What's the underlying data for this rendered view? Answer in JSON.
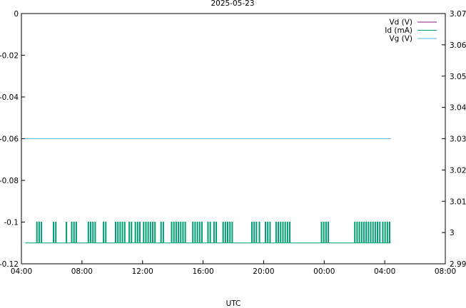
{
  "chart_data": {
    "type": "line",
    "title": "2025-05-23",
    "xlabel": "UTC",
    "ylabel_left": "",
    "ylabel_right": "",
    "x_range_hours": [
      4,
      32
    ],
    "x_ticks": [
      "04:00",
      "08:00",
      "12:00",
      "16:00",
      "20:00",
      "00:00",
      "04:00",
      "08:00"
    ],
    "y_left_range": [
      -0.12,
      0
    ],
    "y_left_ticks": [
      "-0.12",
      "-0.1",
      "-0.08",
      "-0.06",
      "-0.04",
      "-0.02",
      "0"
    ],
    "y_right_range": [
      2.99,
      3.07
    ],
    "y_right_ticks": [
      "2.99",
      "3",
      "3.01",
      "3.02",
      "3.03",
      "3.04",
      "3.05",
      "3.06",
      "3.07"
    ],
    "grid": false,
    "legend_position": "top-right",
    "series": [
      {
        "name": "Vd (V)",
        "color": "#8b1a89",
        "axis": "left",
        "points": []
      },
      {
        "name": "Id (mA)",
        "color": "#009e73",
        "axis": "left",
        "baseline": -0.11,
        "spike_value": -0.1,
        "x_start": 4.25,
        "x_end": 28.4,
        "spike_times": [
          5.0,
          5.15,
          5.3,
          6.1,
          6.25,
          6.95,
          7.3,
          7.45,
          7.6,
          8.4,
          8.55,
          8.7,
          8.85,
          9.4,
          9.55,
          10.2,
          10.35,
          10.5,
          10.65,
          10.8,
          11.1,
          11.25,
          11.5,
          11.65,
          11.8,
          12.05,
          12.2,
          12.35,
          12.5,
          12.65,
          12.8,
          13.2,
          13.35,
          13.9,
          14.05,
          14.2,
          14.35,
          14.5,
          14.65,
          14.8,
          15.3,
          15.45,
          15.6,
          15.75,
          15.9,
          16.3,
          16.45,
          16.7,
          16.85,
          17.3,
          17.45,
          17.6,
          17.75,
          17.9,
          19.2,
          19.35,
          19.5,
          19.7,
          20.1,
          20.25,
          20.4,
          20.8,
          20.95,
          21.1,
          21.25,
          21.4,
          21.55,
          21.7,
          23.8,
          23.95,
          24.1,
          24.25,
          26.0,
          26.15,
          26.3,
          26.45,
          26.6,
          26.75,
          26.9,
          27.05,
          27.2,
          27.35,
          27.5,
          27.65,
          27.85,
          28.0,
          28.15,
          28.3
        ]
      },
      {
        "name": "Vg (V)",
        "color": "#56b4e9",
        "axis": "right",
        "points": [
          [
            4.25,
            3.03
          ],
          [
            28.4,
            3.03
          ]
        ]
      }
    ]
  }
}
